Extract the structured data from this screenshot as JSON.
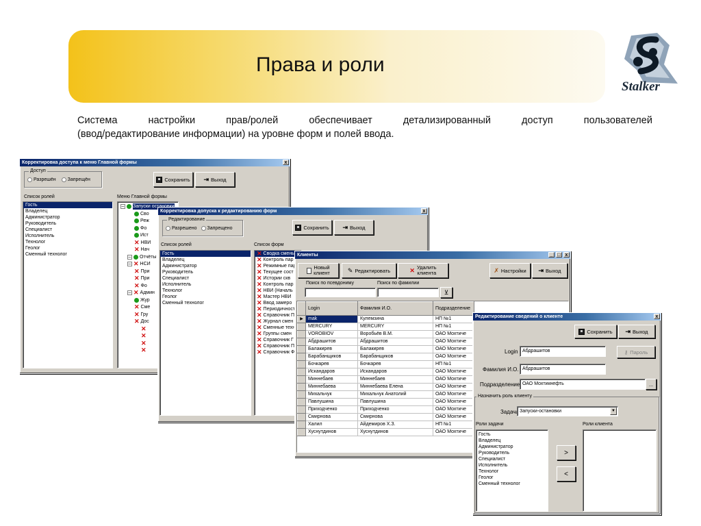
{
  "slide": {
    "title": "Права и роли",
    "logo_text": "Stalker",
    "description_line1_words": [
      "Система",
      "настройки",
      "прав/ролей",
      "обеспечивает",
      "детализированный",
      "доступ",
      "пользователей"
    ],
    "description_line2": "(ввод/редактирование информации) на уровне форм и полей ввода."
  },
  "win1": {
    "title": "Корректировка доступа к меню Главной формы",
    "close_glyph": "x",
    "access_group": "Доступ",
    "radio_allowed": "Разрешён",
    "radio_denied": "Запрещён",
    "save_label": "Сохранить",
    "exit_label": "Выход",
    "roles_label": "Список ролей",
    "menu_label": "Меню Главной формы",
    "roles": [
      "Гость",
      "Владелец",
      "Администратор",
      "Руководитель",
      "Специалист",
      "Исполнитель",
      "Технолог",
      "Геолог",
      "Сменный технолог"
    ],
    "tree": [
      {
        "text": "Запуски остановки",
        "icon": "green-dot"
      },
      {
        "text": "Сво",
        "icon": "green-dot"
      },
      {
        "text": "Реж",
        "icon": "green-dot"
      },
      {
        "text": "Фо",
        "icon": "green-dot"
      },
      {
        "text": "Ист",
        "icon": "green-dot"
      },
      {
        "text": "НВИ",
        "icon": "red-x"
      },
      {
        "text": "Нач",
        "icon": "red-x"
      },
      {
        "text": "Отчёты",
        "icon": "green-dot"
      },
      {
        "text": "НСИ",
        "icon": "red-x"
      },
      {
        "text": "При",
        "icon": "red-x"
      },
      {
        "text": "При",
        "icon": "red-x"
      },
      {
        "text": "Фо",
        "icon": "red-x"
      },
      {
        "text": "Админ",
        "icon": "red-x"
      },
      {
        "text": "Жур",
        "icon": "green-dot"
      },
      {
        "text": "Сме",
        "icon": "red-x"
      },
      {
        "text": "Гру",
        "icon": "red-x"
      },
      {
        "text": "Дос",
        "icon": "red-x"
      },
      {
        "text": "",
        "icon": "red-x"
      },
      {
        "text": "",
        "icon": "red-x"
      },
      {
        "text": "",
        "icon": "red-x"
      },
      {
        "text": "",
        "icon": "red-x"
      }
    ]
  },
  "win2": {
    "title": "Корректировка допуска к редактированию форм",
    "close_glyph": "x",
    "edit_group": "Редактирование",
    "radio_allowed": "Разрешено",
    "radio_denied": "Запрещено",
    "save_label": "Сохранить",
    "exit_label": "Выход",
    "roles_label": "Список ролей",
    "forms_label": "Список форм",
    "roles": [
      "Гость",
      "Владелец",
      "Администратор",
      "Руководитель",
      "Специалист",
      "Исполнитель",
      "Технолог",
      "Геолог",
      "Сменный технолог"
    ],
    "forms": [
      "Сводка смены",
      "Контроль пар",
      "Режимные пар",
      "Текущее сост",
      "Истории скв",
      "Контроль пар",
      "НВИ (Началь",
      "Мастер НВИ",
      "Ввод замеро",
      "Периодичност",
      "Справочник Пр",
      "Журнал смен",
      "Сменные техн",
      "Группы смен",
      "Справочник Г",
      "Справочник П",
      "Справочник Ф"
    ]
  },
  "win3": {
    "title": "Клиенты",
    "min_glyph": "_",
    "max_glyph": "□",
    "close_glyph": "x",
    "new_client_1": "Новый",
    "new_client_2": "клиент",
    "edit_label": "Редактировать",
    "delete_1": "Удалить",
    "delete_2": "клиента",
    "settings_label": "Настройки",
    "exit_label": "Выход",
    "search_alias": "Поиск по псевдониму",
    "search_surname": "Поиск по фамилии",
    "columns": [
      "Login",
      "Фамилия И.О.",
      "Подразделение"
    ],
    "rows": [
      [
        "mak",
        "Кулемзина",
        "НП №1"
      ],
      [
        "MERCURY",
        "MERCURY",
        "НП №1"
      ],
      [
        "VOROBIOV",
        "Воробьёв В.М.",
        "ОАО Мохтиче"
      ],
      [
        "Абдрашитов",
        "Абдрашитов",
        "ОАО Мохтиче"
      ],
      [
        "Балакирев",
        "Балакирев",
        "ОАО Мохтиче"
      ],
      [
        "Барабанщиков",
        "Барабанщиков",
        "ОАО Мохтиче"
      ],
      [
        "Бочкарев",
        "Бочкарев",
        "НП №1"
      ],
      [
        "Искандаров",
        "Искандаров",
        "ОАО Мохтиче"
      ],
      [
        "Миннебаев",
        "Миннебаев",
        "ОАО Мохтиче"
      ],
      [
        "Миннебаева",
        "Миннебаева Елена",
        "ОАО Мохтиче"
      ],
      [
        "Михальчук",
        "Михальчук Анатолий",
        "ОАО Мохтиче"
      ],
      [
        "Павлушина",
        "Павлушина",
        "ОАО Мохтиче"
      ],
      [
        "Приходченко",
        "Приходченко",
        "ОАО Мохтиче"
      ],
      [
        "Смирнова",
        "Смирнова",
        "ОАО Мохтиче"
      ],
      [
        "Халил",
        "Айдемиров Х.З.",
        "НП №1"
      ],
      [
        "Хуснутдинов",
        "Хуснутдинов",
        "ОАО Мохтиче"
      ]
    ]
  },
  "win4": {
    "title": "Редактирование сведений о клиенте",
    "close_glyph": "x",
    "save_label": "Сохранить",
    "exit_label": "Выход",
    "login_label": "Login",
    "login_value": "Абдрашитов",
    "password_label": "Пароль",
    "name_label": "Фамилия И.О.",
    "name_value": "Абдрашитов",
    "dept_label": "Подразделение",
    "dept_value": "ОАО Мохтикнефть",
    "dots": "...",
    "assign_group": "Назначить роль клиенту",
    "task_label": "Задача",
    "task_value": "Запуски-остановки",
    "task_roles_label": "Роли задачи",
    "client_roles_label": "Роли клиента",
    "task_roles": [
      "Гость",
      "Владелец",
      "Администратор",
      "Руководитель",
      "Специалист",
      "Исполнитель",
      "Технолог",
      "Геолог",
      "Сменный технолог"
    ],
    "add_label": ">",
    "remove_label": "<"
  }
}
